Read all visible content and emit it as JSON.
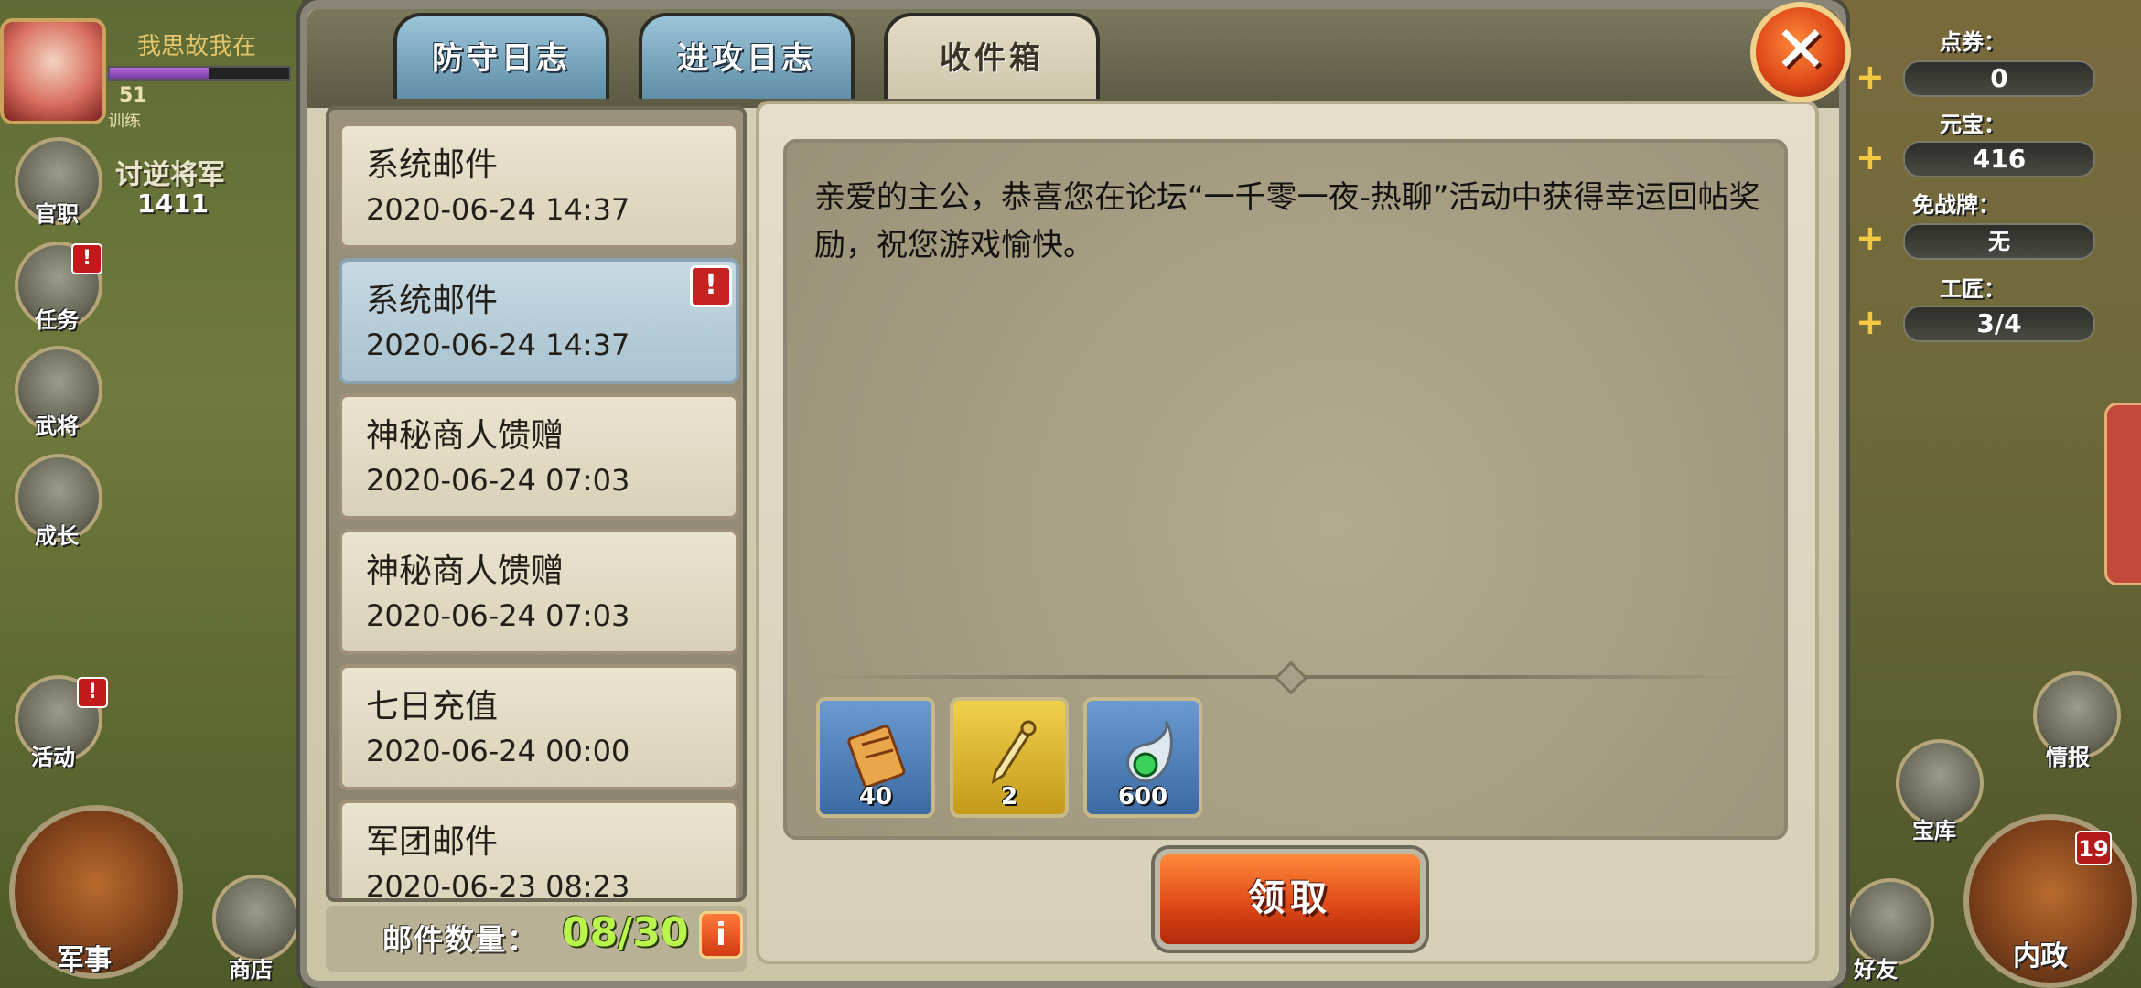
{
  "hud": {
    "player_name": "我思故我在",
    "level": "51",
    "level_sub": "训练",
    "rank_title": "讨逆将军",
    "rank_score": "1411",
    "side_buttons": [
      "官职",
      "任务",
      "武将",
      "成长",
      "活动"
    ],
    "bottom_left": [
      "军事",
      "商店"
    ],
    "resources": [
      {
        "label": "点券：",
        "value": "0"
      },
      {
        "label": "元宝：",
        "value": "416"
      },
      {
        "label": "免战牌：",
        "value": "无"
      },
      {
        "label": "工匠：",
        "value": "3/4"
      }
    ],
    "right_buttons": [
      "情报",
      "宝库",
      "好友",
      "内政"
    ],
    "notification_count": "19",
    "alert_mark": "!"
  },
  "dialog": {
    "tabs": [
      {
        "label": "防守日志",
        "active": false
      },
      {
        "label": "进攻日志",
        "active": false
      },
      {
        "label": "收件箱",
        "active": true
      }
    ],
    "close_glyph": "✕",
    "mails": [
      {
        "title": "系统邮件",
        "date": "2020-06-24 14:37",
        "selected": false,
        "unread": false
      },
      {
        "title": "系统邮件",
        "date": "2020-06-24 14:37",
        "selected": true,
        "unread": true
      },
      {
        "title": "神秘商人馈赠",
        "date": "2020-06-24 07:03",
        "selected": false,
        "unread": false
      },
      {
        "title": "神秘商人馈赠",
        "date": "2020-06-24 07:03",
        "selected": false,
        "unread": false
      },
      {
        "title": "七日充值",
        "date": "2020-06-24 00:00",
        "selected": false,
        "unread": false
      },
      {
        "title": "军团邮件",
        "date": "2020-06-23 08:23",
        "selected": false,
        "unread": false
      }
    ],
    "unread_mark": "!",
    "mail_count_label": "邮件数量：",
    "mail_count_value": "08/30",
    "info_glyph": "i",
    "message": "亲爱的主公，恭喜您在论坛“一千零一夜-热聊”活动中获得幸运回帖奖励，祝您游戏愉快。",
    "rewards": [
      {
        "icon": "scroll-icon",
        "qty": "40",
        "bg": "#4f7fb8"
      },
      {
        "icon": "horn-icon",
        "qty": "2",
        "bg": "#d7b52a"
      },
      {
        "icon": "jade-icon",
        "qty": "600",
        "bg": "#4f7fb8"
      }
    ],
    "claim_label": "领取"
  },
  "colors": {
    "accent_orange": "#e04a18",
    "selected_mail": "#a9c3d0",
    "count_green": "#b9f54a"
  }
}
